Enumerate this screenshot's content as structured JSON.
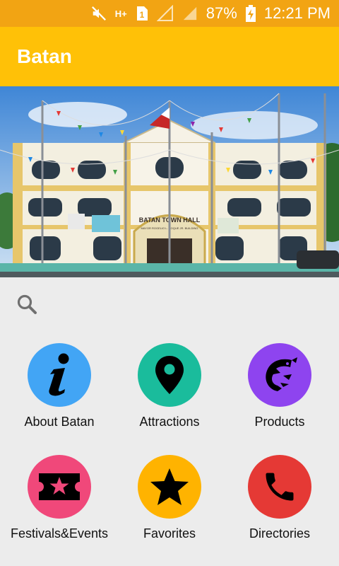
{
  "status_bar": {
    "battery_percent": "87%",
    "time": "12:21 PM",
    "sim_label": "1",
    "network_label": "H+"
  },
  "app_bar": {
    "title": "Batan"
  },
  "hero": {
    "sign_text": "BATAN TOWN HALL",
    "sign_subtext": "MAYOR ROGELIO L. ROQUE JR. BUILDING"
  },
  "search": {
    "icon": "search-icon"
  },
  "menu": {
    "items": [
      {
        "label": "About Batan",
        "icon": "info-icon",
        "color": "#42a5f5"
      },
      {
        "label": "Attractions",
        "icon": "map-pin-icon",
        "color": "#1abc9c"
      },
      {
        "label": "Products",
        "icon": "shrimp-icon",
        "color": "#8e44ef"
      },
      {
        "label": "Festivals&Events",
        "icon": "ticket-star-icon",
        "color": "#f0487a"
      },
      {
        "label": "Favorites",
        "icon": "star-icon",
        "color": "#ffb300"
      },
      {
        "label": "Directories",
        "icon": "phone-icon",
        "color": "#e53935"
      }
    ]
  }
}
